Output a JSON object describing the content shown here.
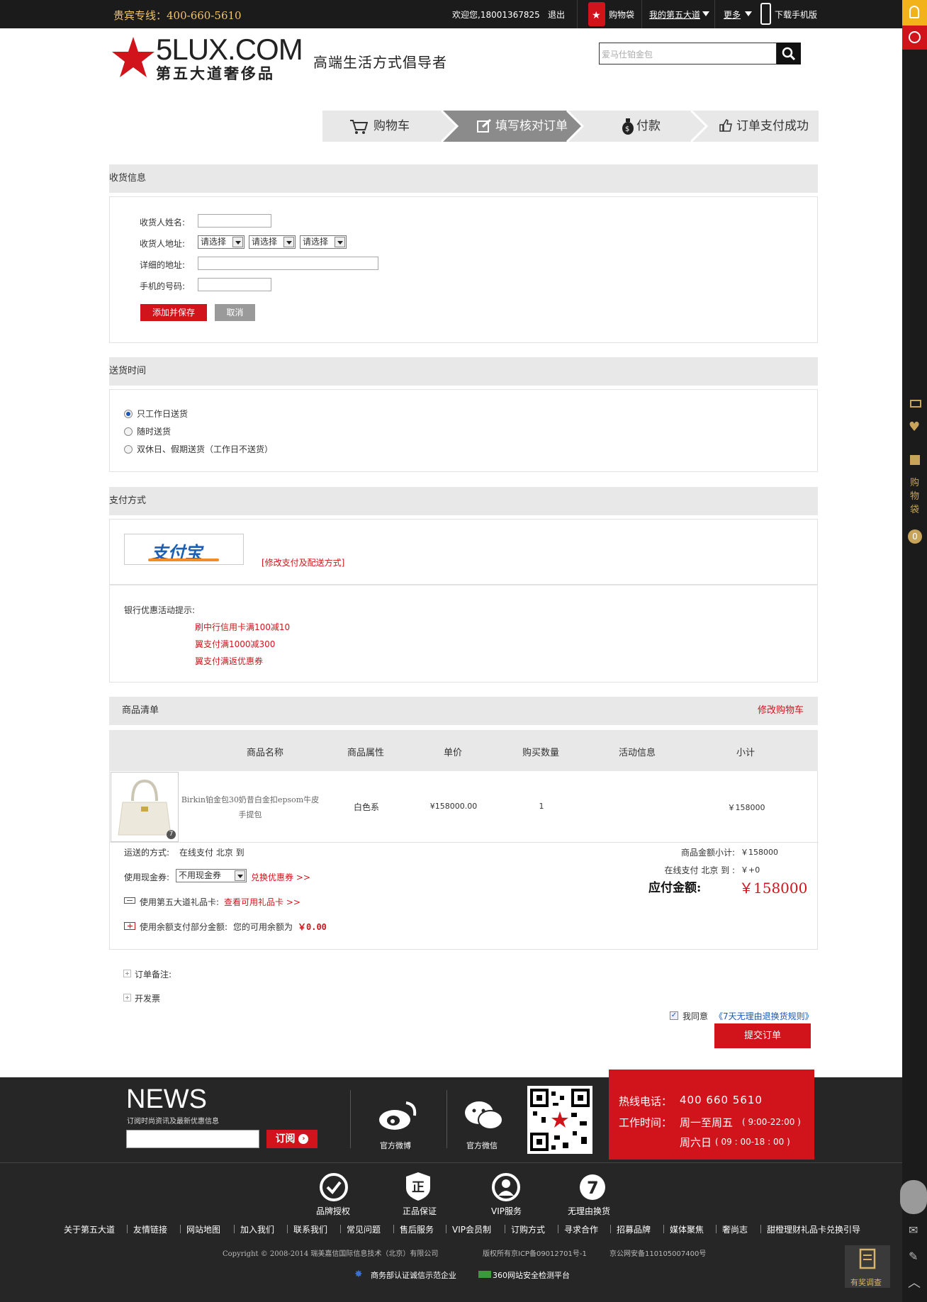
{
  "topbar": {
    "hotline": "贵宾专线：400-660-5610",
    "welcome": "欢迎您,18001367825",
    "logout": "退出",
    "cart": "购物袋",
    "my_account": "我的第五大道",
    "more": "更多",
    "download_app": "下载手机版"
  },
  "header": {
    "logo_main": "5LUX.COM",
    "logo_sub": "第五大道奢侈品",
    "slogan": "高端生活方式倡导者",
    "search_placeholder": "爱马仕铂金包"
  },
  "steps": [
    {
      "label": "购物车"
    },
    {
      "label": "填写核对订单",
      "active": true
    },
    {
      "label": "付款"
    },
    {
      "label": "订单支付成功"
    }
  ],
  "shipping": {
    "title": "收货信息",
    "name_label": "收货人姓名:",
    "address_label": "收货人地址:",
    "select_placeholder": "请选择",
    "detail_label": "详细的地址:",
    "phone_label": "手机的号码:",
    "save_button": "添加并保存",
    "cancel_button": "取消"
  },
  "delivery": {
    "title": "送货时间",
    "options": [
      "只工作日送货",
      "随时送货",
      "双休日、假期送货（工作日不送货）"
    ],
    "selected_index": 0
  },
  "payment": {
    "title": "支付方式",
    "alipay_label": "支付宝",
    "modify_link": "[修改支付及配送方式]",
    "bank_title": "银行优惠活动提示:",
    "bank_promos": [
      "刷中行信用卡满100减10",
      "翼支付满1000减300",
      "翼支付满返优惠券"
    ]
  },
  "product_list": {
    "title": "商品清单",
    "modify_cart": "修改购物车",
    "headers": [
      "商品名称",
      "商品属性",
      "单价",
      "购买数量",
      "活动信息",
      "小计"
    ],
    "items": [
      {
        "name": "Birkin铂金包30奶昔白金扣epsom牛皮手提包",
        "attr": "白色系",
        "price": "¥158000.00",
        "qty": "1",
        "activity": "",
        "subtotal": "￥158000",
        "badge": "7"
      }
    ]
  },
  "summary": {
    "shipping_method_label": "运送的方式:",
    "shipping_method_value": "在线支付 北京 到",
    "coupon_label": "使用现金券:",
    "coupon_value": "不用现金券",
    "coupon_link": "兑换优惠券 >>",
    "giftcard_label": "使用第五大道礼品卡:",
    "giftcard_link": "查看可用礼品卡 >>",
    "balance_label": "使用余额支付部分金额:",
    "balance_text": "您的可用余额为",
    "balance_value": "￥0.00",
    "subtotal_label": "商品金额小计:",
    "subtotal_value": "￥158000",
    "freight_label": "在线支付 北京 到 :",
    "freight_value": "￥+0",
    "total_label": "应付金额:",
    "total_value": "￥158000"
  },
  "extras": {
    "order_note": "订单备注:",
    "invoice": "开发票",
    "agree_text": "我同意",
    "agree_link": "《7天无理由退换货规则》",
    "submit_button": "提交订单"
  },
  "footer": {
    "news_title": "NEWS",
    "news_sub": "订阅时尚资讯及最新优惠信息",
    "subscribe": "订阅",
    "weibo": "官方微博",
    "weixin": "官方微信",
    "hotline_label": "热线电话：",
    "hotline_value": "400 660 5610",
    "hours_label": "工作时间：",
    "hours_week": "周一至周五",
    "hours_week_time": "( 9:00-22:00 )",
    "hours_sat": "周六日",
    "hours_sat_time": "( 09 : 00-18 : 00 )",
    "guarantees": [
      "品牌授权",
      "正品保证",
      "VIP服务",
      "无理由换货"
    ],
    "nav_links": [
      "关于第五大道",
      "友情链接",
      "网站地图",
      "加入我们",
      "联系我们",
      "常见问题",
      "售后服务",
      "VIP会员制",
      "订购方式",
      "寻求合作",
      "招募品牌",
      "媒体聚焦",
      "奢尚志",
      "甜橙理财礼品卡兑换引导"
    ],
    "copyright": "Copyright © 2008-2014 瑞美嘉信国际信息技术（北京）有限公司",
    "icp": "版权所有京ICP备09012701号-1",
    "police": "京公网安备110105007400号",
    "badge1": "商务部认证诚信示范企业",
    "badge2": "360网站安全检测平台",
    "survey": "有奖调查"
  },
  "sidebar": {
    "cart_label": "购物袋",
    "cart_count": "0"
  },
  "colors": {
    "brand_red": "#d1141b",
    "dark": "#1b1b1b",
    "accent_gold": "#f2c46a"
  }
}
